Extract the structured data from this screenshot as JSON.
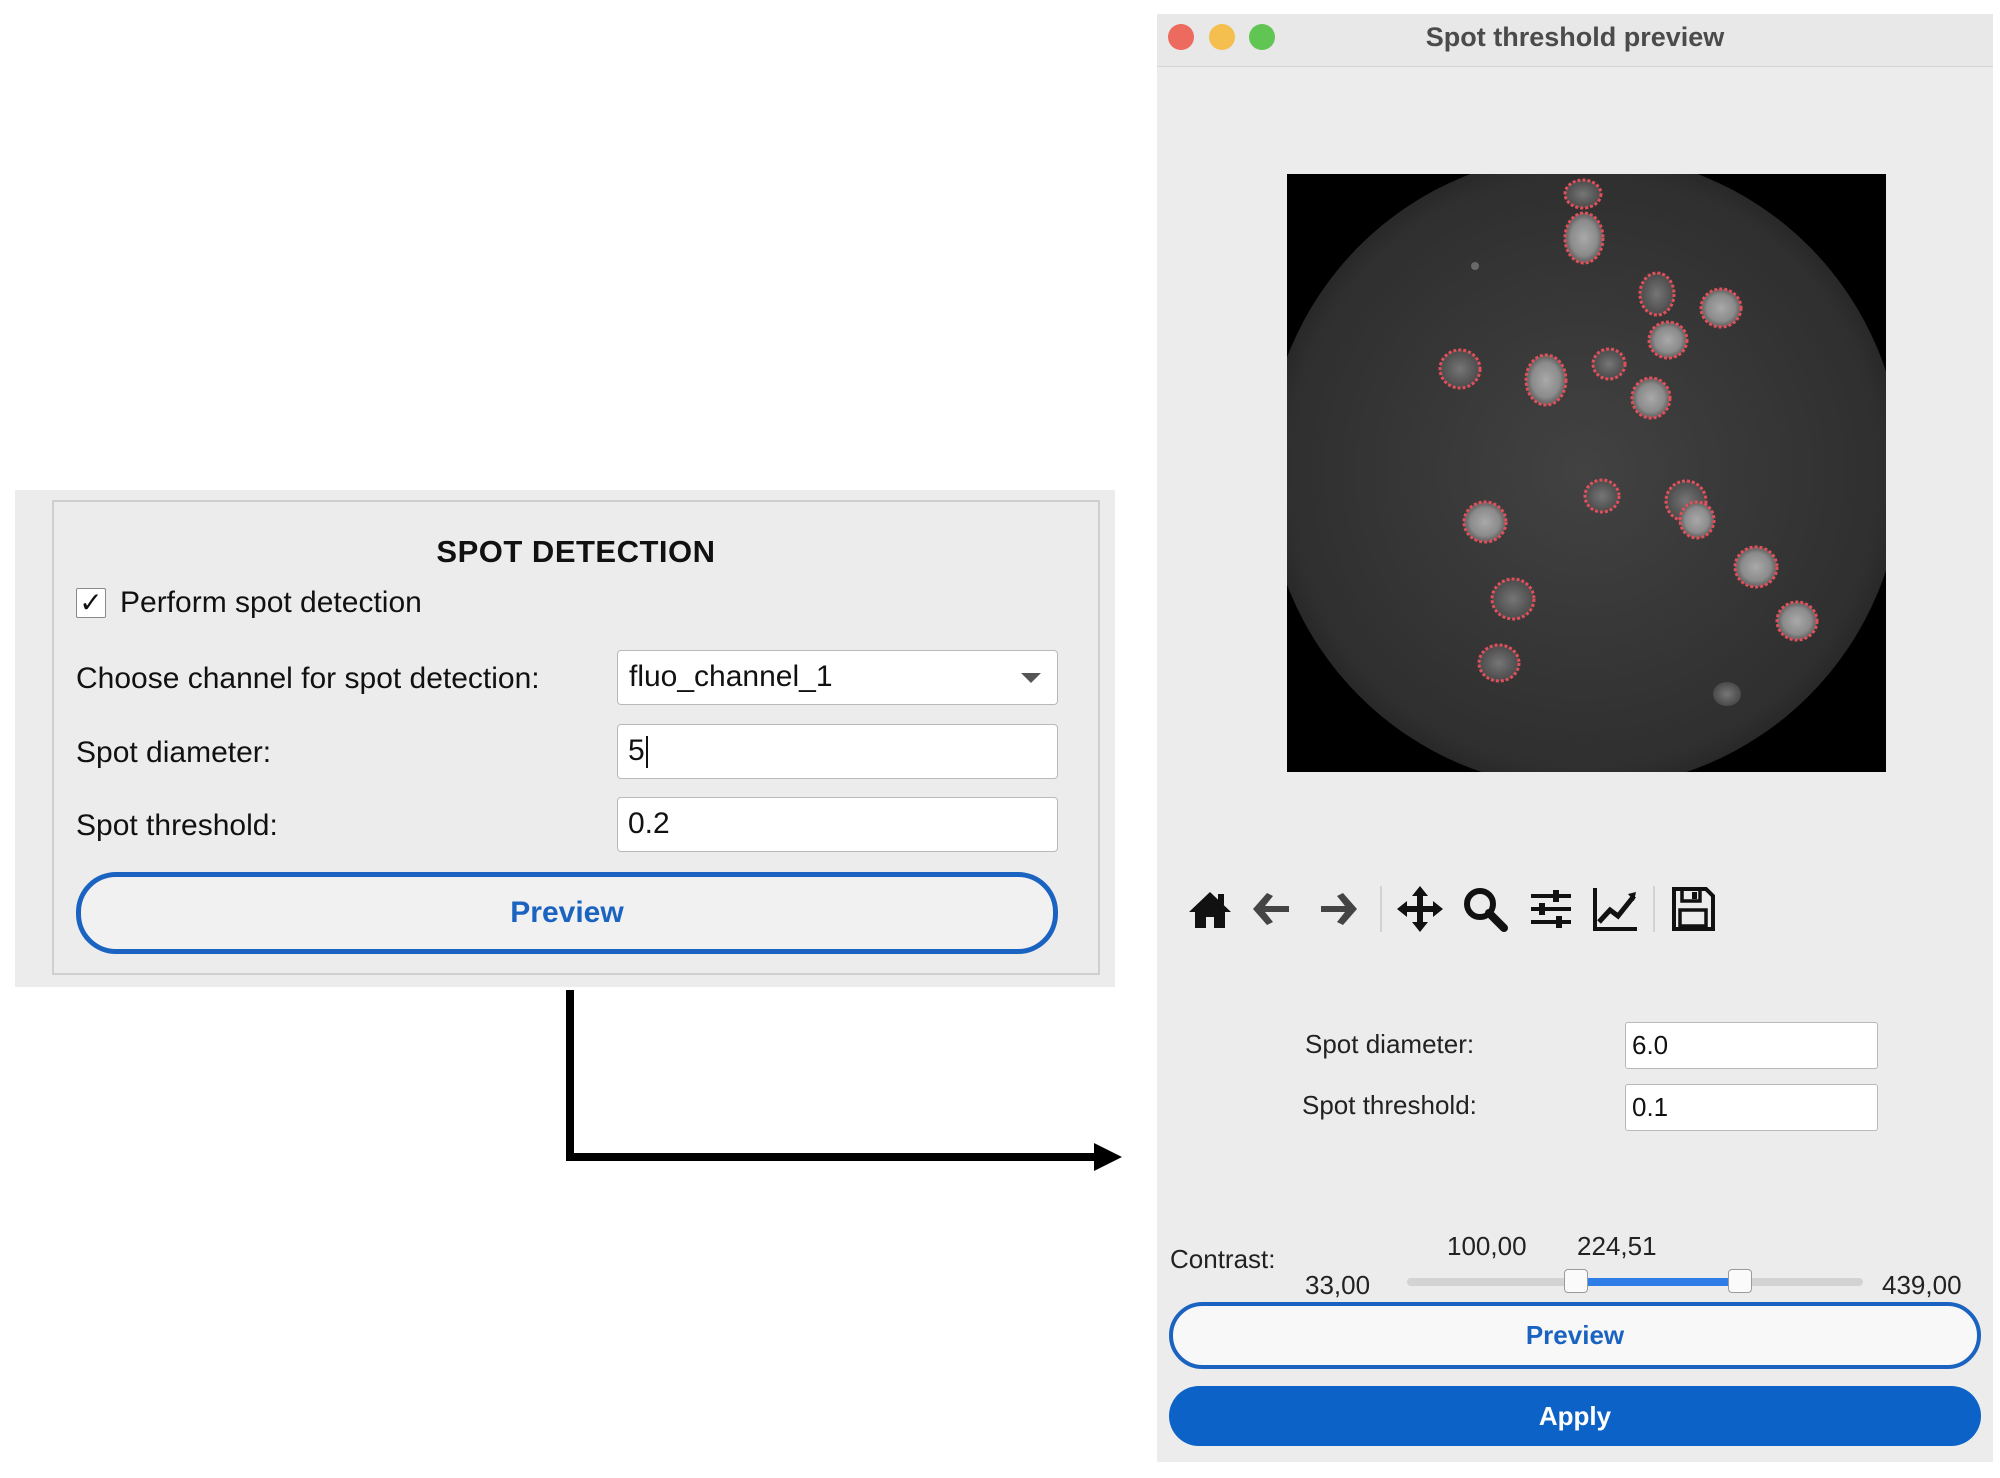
{
  "spot_detection_panel": {
    "title": "SPOT DETECTION",
    "perform_checkbox": {
      "label": "Perform spot detection",
      "checked": true,
      "check_glyph": "✓"
    },
    "channel_label": "Choose channel for spot detection:",
    "channel_value": "fluo_channel_1",
    "diameter_label": "Spot diameter:",
    "diameter_value": "5",
    "threshold_label": "Spot threshold:",
    "threshold_value": "0.2",
    "preview_label": "Preview"
  },
  "preview_window": {
    "title": "Spot threshold preview",
    "toolbar": [
      "home-icon",
      "back-arrow-icon",
      "forward-arrow-icon",
      "pan-icon",
      "zoom-icon",
      "configure-subplots-icon",
      "edit-axis-icon",
      "save-icon"
    ],
    "diameter_label": "Spot diameter:",
    "diameter_value": "6.0",
    "threshold_label": "Spot threshold:",
    "threshold_value": "0.1",
    "contrast": {
      "label": "Contrast:",
      "min_label": "33,00",
      "max_label": "439,00",
      "low_label": "100,00",
      "high_label": "224,51",
      "min": 33.0,
      "max": 439.0,
      "low": 100.0,
      "high": 224.51
    },
    "preview_label": "Preview",
    "apply_label": "Apply"
  },
  "colors": {
    "accent_blue": "#1b63c1",
    "apply_blue": "#0d62c8",
    "slider_fill": "#2f7ee7",
    "spot_red": "#e0505a"
  }
}
